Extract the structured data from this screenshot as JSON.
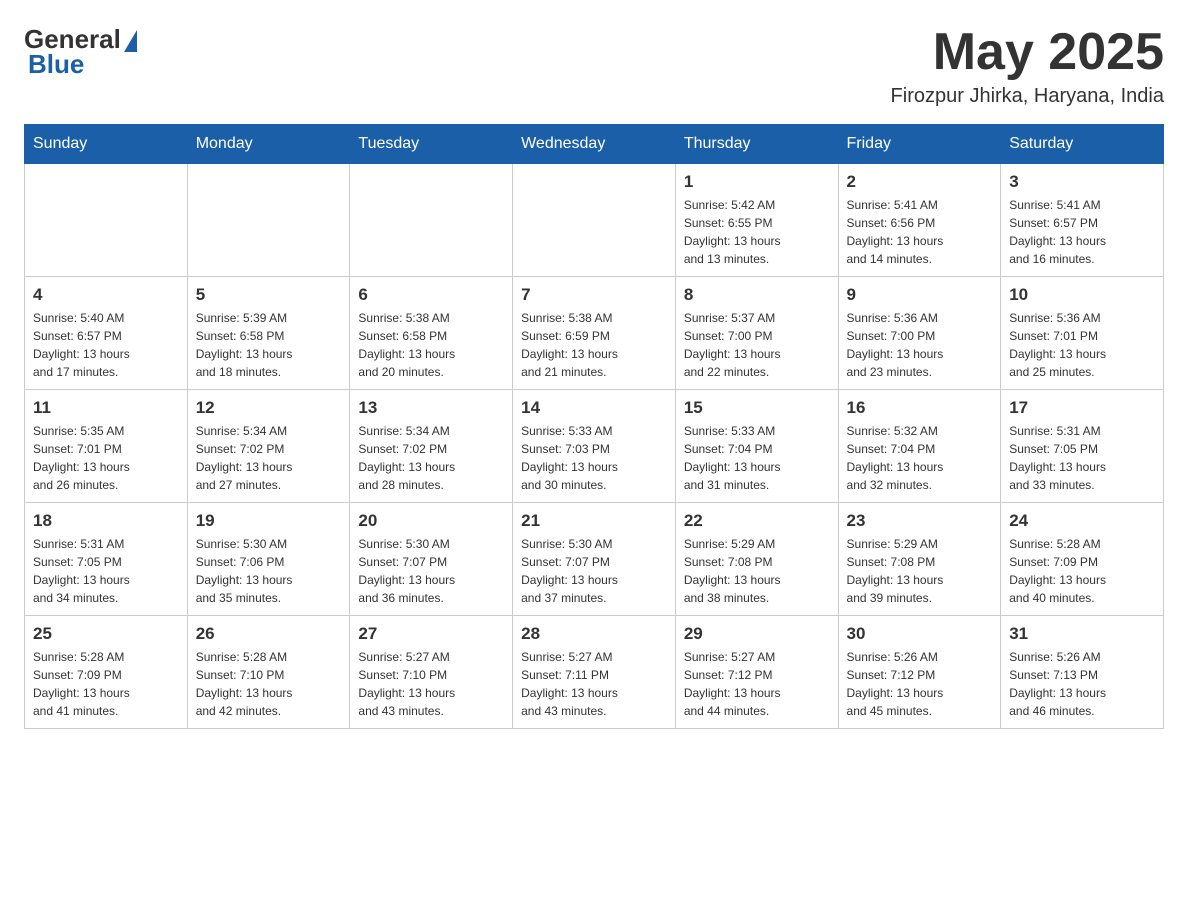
{
  "header": {
    "logo": {
      "general": "General",
      "triangle": "▶",
      "blue": "Blue"
    },
    "title": "May 2025",
    "location": "Firozpur Jhirka, Haryana, India"
  },
  "calendar": {
    "days_of_week": [
      "Sunday",
      "Monday",
      "Tuesday",
      "Wednesday",
      "Thursday",
      "Friday",
      "Saturday"
    ],
    "weeks": [
      [
        {
          "day": "",
          "info": ""
        },
        {
          "day": "",
          "info": ""
        },
        {
          "day": "",
          "info": ""
        },
        {
          "day": "",
          "info": ""
        },
        {
          "day": "1",
          "info": "Sunrise: 5:42 AM\nSunset: 6:55 PM\nDaylight: 13 hours\nand 13 minutes."
        },
        {
          "day": "2",
          "info": "Sunrise: 5:41 AM\nSunset: 6:56 PM\nDaylight: 13 hours\nand 14 minutes."
        },
        {
          "day": "3",
          "info": "Sunrise: 5:41 AM\nSunset: 6:57 PM\nDaylight: 13 hours\nand 16 minutes."
        }
      ],
      [
        {
          "day": "4",
          "info": "Sunrise: 5:40 AM\nSunset: 6:57 PM\nDaylight: 13 hours\nand 17 minutes."
        },
        {
          "day": "5",
          "info": "Sunrise: 5:39 AM\nSunset: 6:58 PM\nDaylight: 13 hours\nand 18 minutes."
        },
        {
          "day": "6",
          "info": "Sunrise: 5:38 AM\nSunset: 6:58 PM\nDaylight: 13 hours\nand 20 minutes."
        },
        {
          "day": "7",
          "info": "Sunrise: 5:38 AM\nSunset: 6:59 PM\nDaylight: 13 hours\nand 21 minutes."
        },
        {
          "day": "8",
          "info": "Sunrise: 5:37 AM\nSunset: 7:00 PM\nDaylight: 13 hours\nand 22 minutes."
        },
        {
          "day": "9",
          "info": "Sunrise: 5:36 AM\nSunset: 7:00 PM\nDaylight: 13 hours\nand 23 minutes."
        },
        {
          "day": "10",
          "info": "Sunrise: 5:36 AM\nSunset: 7:01 PM\nDaylight: 13 hours\nand 25 minutes."
        }
      ],
      [
        {
          "day": "11",
          "info": "Sunrise: 5:35 AM\nSunset: 7:01 PM\nDaylight: 13 hours\nand 26 minutes."
        },
        {
          "day": "12",
          "info": "Sunrise: 5:34 AM\nSunset: 7:02 PM\nDaylight: 13 hours\nand 27 minutes."
        },
        {
          "day": "13",
          "info": "Sunrise: 5:34 AM\nSunset: 7:02 PM\nDaylight: 13 hours\nand 28 minutes."
        },
        {
          "day": "14",
          "info": "Sunrise: 5:33 AM\nSunset: 7:03 PM\nDaylight: 13 hours\nand 30 minutes."
        },
        {
          "day": "15",
          "info": "Sunrise: 5:33 AM\nSunset: 7:04 PM\nDaylight: 13 hours\nand 31 minutes."
        },
        {
          "day": "16",
          "info": "Sunrise: 5:32 AM\nSunset: 7:04 PM\nDaylight: 13 hours\nand 32 minutes."
        },
        {
          "day": "17",
          "info": "Sunrise: 5:31 AM\nSunset: 7:05 PM\nDaylight: 13 hours\nand 33 minutes."
        }
      ],
      [
        {
          "day": "18",
          "info": "Sunrise: 5:31 AM\nSunset: 7:05 PM\nDaylight: 13 hours\nand 34 minutes."
        },
        {
          "day": "19",
          "info": "Sunrise: 5:30 AM\nSunset: 7:06 PM\nDaylight: 13 hours\nand 35 minutes."
        },
        {
          "day": "20",
          "info": "Sunrise: 5:30 AM\nSunset: 7:07 PM\nDaylight: 13 hours\nand 36 minutes."
        },
        {
          "day": "21",
          "info": "Sunrise: 5:30 AM\nSunset: 7:07 PM\nDaylight: 13 hours\nand 37 minutes."
        },
        {
          "day": "22",
          "info": "Sunrise: 5:29 AM\nSunset: 7:08 PM\nDaylight: 13 hours\nand 38 minutes."
        },
        {
          "day": "23",
          "info": "Sunrise: 5:29 AM\nSunset: 7:08 PM\nDaylight: 13 hours\nand 39 minutes."
        },
        {
          "day": "24",
          "info": "Sunrise: 5:28 AM\nSunset: 7:09 PM\nDaylight: 13 hours\nand 40 minutes."
        }
      ],
      [
        {
          "day": "25",
          "info": "Sunrise: 5:28 AM\nSunset: 7:09 PM\nDaylight: 13 hours\nand 41 minutes."
        },
        {
          "day": "26",
          "info": "Sunrise: 5:28 AM\nSunset: 7:10 PM\nDaylight: 13 hours\nand 42 minutes."
        },
        {
          "day": "27",
          "info": "Sunrise: 5:27 AM\nSunset: 7:10 PM\nDaylight: 13 hours\nand 43 minutes."
        },
        {
          "day": "28",
          "info": "Sunrise: 5:27 AM\nSunset: 7:11 PM\nDaylight: 13 hours\nand 43 minutes."
        },
        {
          "day": "29",
          "info": "Sunrise: 5:27 AM\nSunset: 7:12 PM\nDaylight: 13 hours\nand 44 minutes."
        },
        {
          "day": "30",
          "info": "Sunrise: 5:26 AM\nSunset: 7:12 PM\nDaylight: 13 hours\nand 45 minutes."
        },
        {
          "day": "31",
          "info": "Sunrise: 5:26 AM\nSunset: 7:13 PM\nDaylight: 13 hours\nand 46 minutes."
        }
      ]
    ]
  }
}
